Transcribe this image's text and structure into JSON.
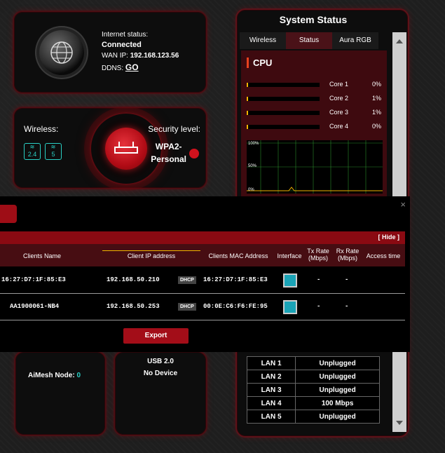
{
  "internet": {
    "status_label": "Internet status:",
    "status_value": "Connected",
    "wan_ip_label": "WAN IP:",
    "wan_ip": "192.168.123.56",
    "ddns_label": "DDNS:",
    "ddns_link": "GO"
  },
  "wireless": {
    "label": "Wireless:",
    "band_24": "2.4",
    "band_5": "5",
    "security_label": "Security level:",
    "security_value_line1": "WPA2-",
    "security_value_line2": "Personal"
  },
  "system_status": {
    "title": "System Status",
    "tabs": [
      "Wireless",
      "Status",
      "Aura RGB"
    ],
    "active_tab": "Status",
    "cpu_title": "CPU",
    "cores": [
      {
        "name": "Core 1",
        "pct": "0%",
        "level": 0.0
      },
      {
        "name": "Core 2",
        "pct": "1%",
        "level": 0.01
      },
      {
        "name": "Core 3",
        "pct": "1%",
        "level": 0.01
      },
      {
        "name": "Core 4",
        "pct": "0%",
        "level": 0.0
      }
    ],
    "graph_labels": [
      "100%",
      "50%",
      "0%"
    ],
    "lan_ports": [
      {
        "port": "LAN 1",
        "status": "Unplugged"
      },
      {
        "port": "LAN 2",
        "status": "Unplugged"
      },
      {
        "port": "LAN 3",
        "status": "Unplugged"
      },
      {
        "port": "LAN 4",
        "status": "100 Mbps"
      },
      {
        "port": "LAN 5",
        "status": "Unplugged"
      }
    ]
  },
  "aimesh": {
    "label": "AiMesh Node:",
    "count": "0"
  },
  "usb": {
    "label": "USB 2.0",
    "status": "No Device"
  },
  "clients_modal": {
    "close": "×",
    "hide_link": "[ Hide ]",
    "headers": [
      "Clients Name",
      "Client IP address",
      "Clients MAC Address",
      "Interface",
      "Tx Rate (Mbps)",
      "Rx Rate (Mbps)",
      "Access time"
    ],
    "rows": [
      {
        "name": "16:27:D7:1F:85:E3",
        "ip": "192.168.50.210",
        "type": "DHCP",
        "mac": "16:27:D7:1F:85:E3",
        "tx": "-",
        "rx": "-"
      },
      {
        "name": "AA1900061-NB4",
        "ip": "192.168.50.253",
        "type": "DHCP",
        "mac": "00:0E:C6:F6:FE:95",
        "tx": "-",
        "rx": "-"
      }
    ],
    "export_label": "Export"
  },
  "colors": {
    "accent": "#a30d18",
    "teal": "#2ad0c5",
    "cpu_bar": "#f3b400"
  }
}
